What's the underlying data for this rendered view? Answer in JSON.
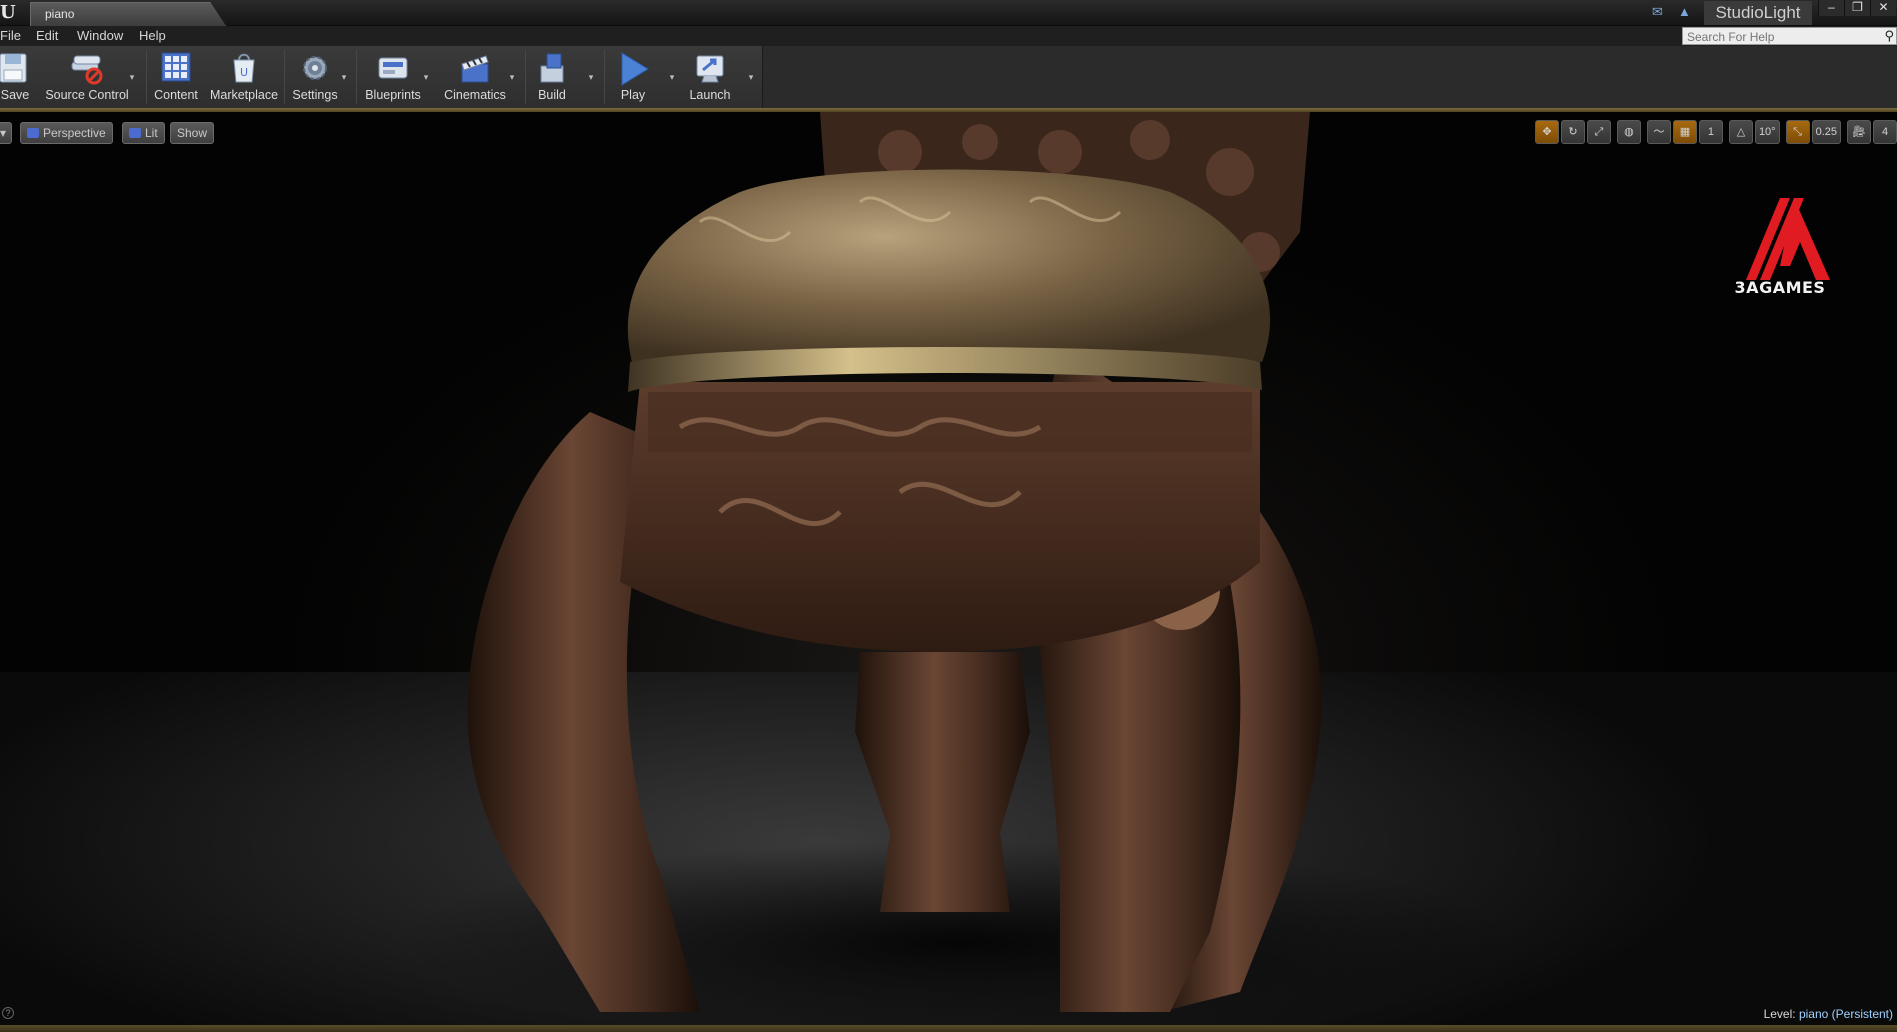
{
  "window": {
    "tab_title": "piano",
    "project_name": "StudioLight",
    "minimize_glyph": "–",
    "maximize_glyph": "❐",
    "close_glyph": "✕"
  },
  "menu": {
    "items": [
      "File",
      "Edit",
      "Window",
      "Help"
    ],
    "search_placeholder": "Search For Help"
  },
  "toolbar": {
    "buttons": [
      {
        "label": "Save",
        "icon": "save-icon"
      },
      {
        "label": "Source Control",
        "icon": "source-control-icon"
      },
      {
        "label": "Content",
        "icon": "content-icon"
      },
      {
        "label": "Marketplace",
        "icon": "marketplace-icon"
      },
      {
        "label": "Settings",
        "icon": "settings-icon"
      },
      {
        "label": "Blueprints",
        "icon": "blueprints-icon"
      },
      {
        "label": "Cinematics",
        "icon": "cinematics-icon"
      },
      {
        "label": "Build",
        "icon": "build-icon"
      },
      {
        "label": "Play",
        "icon": "play-icon"
      },
      {
        "label": "Launch",
        "icon": "launch-icon"
      }
    ]
  },
  "viewport": {
    "perspective_label": "Perspective",
    "lit_label": "Lit",
    "show_label": "Show",
    "rotation_snap": "10°",
    "scale_snap": "0.25",
    "camera_speed": "4",
    "grid_value": "1",
    "logo_text": "3AGAMES",
    "level_label": "Level:",
    "level_name": "piano (Persistent)"
  },
  "colors": {
    "accent_gold": "#7c6b3e",
    "wood_dark": "#2a1810",
    "wood_mid": "#5a3a28",
    "cushion": "#6b5a40",
    "logo_red": "#e01b22",
    "level_name": "#9fd2ff"
  }
}
